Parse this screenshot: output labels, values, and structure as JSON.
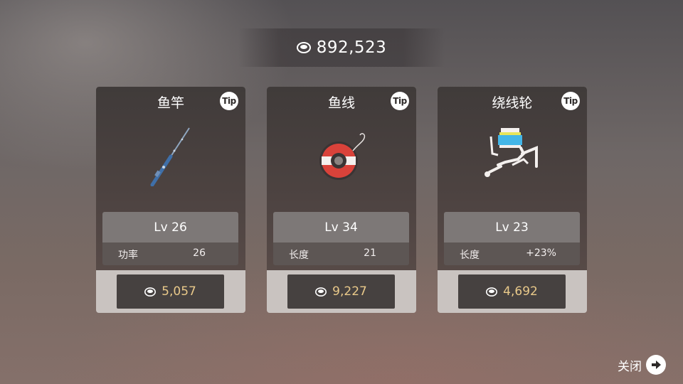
{
  "header": {
    "currency_icon": "coin-icon",
    "balance": "892,523"
  },
  "cards": [
    {
      "title": "鱼竿",
      "tip": "Tip",
      "icon": "fishing-rod-icon",
      "level": "Lv 26",
      "stat_label": "功率",
      "stat_value": "26",
      "price": "5,057"
    },
    {
      "title": "鱼线",
      "tip": "Tip",
      "icon": "fishing-line-spool-icon",
      "level": "Lv 34",
      "stat_label": "长度",
      "stat_value": "21",
      "price": "9,227"
    },
    {
      "title": "绕线轮",
      "tip": "Tip",
      "icon": "fishing-reel-icon",
      "level": "Lv 23",
      "stat_label": "长度",
      "stat_value": "+23%",
      "price": "4,692"
    }
  ],
  "close": {
    "label": "关闭",
    "icon": "arrow-right-circle-icon"
  },
  "colors": {
    "price_text": "#e9c98a",
    "card_dark": "#403b3a",
    "card_light": "#c9c3c0"
  }
}
